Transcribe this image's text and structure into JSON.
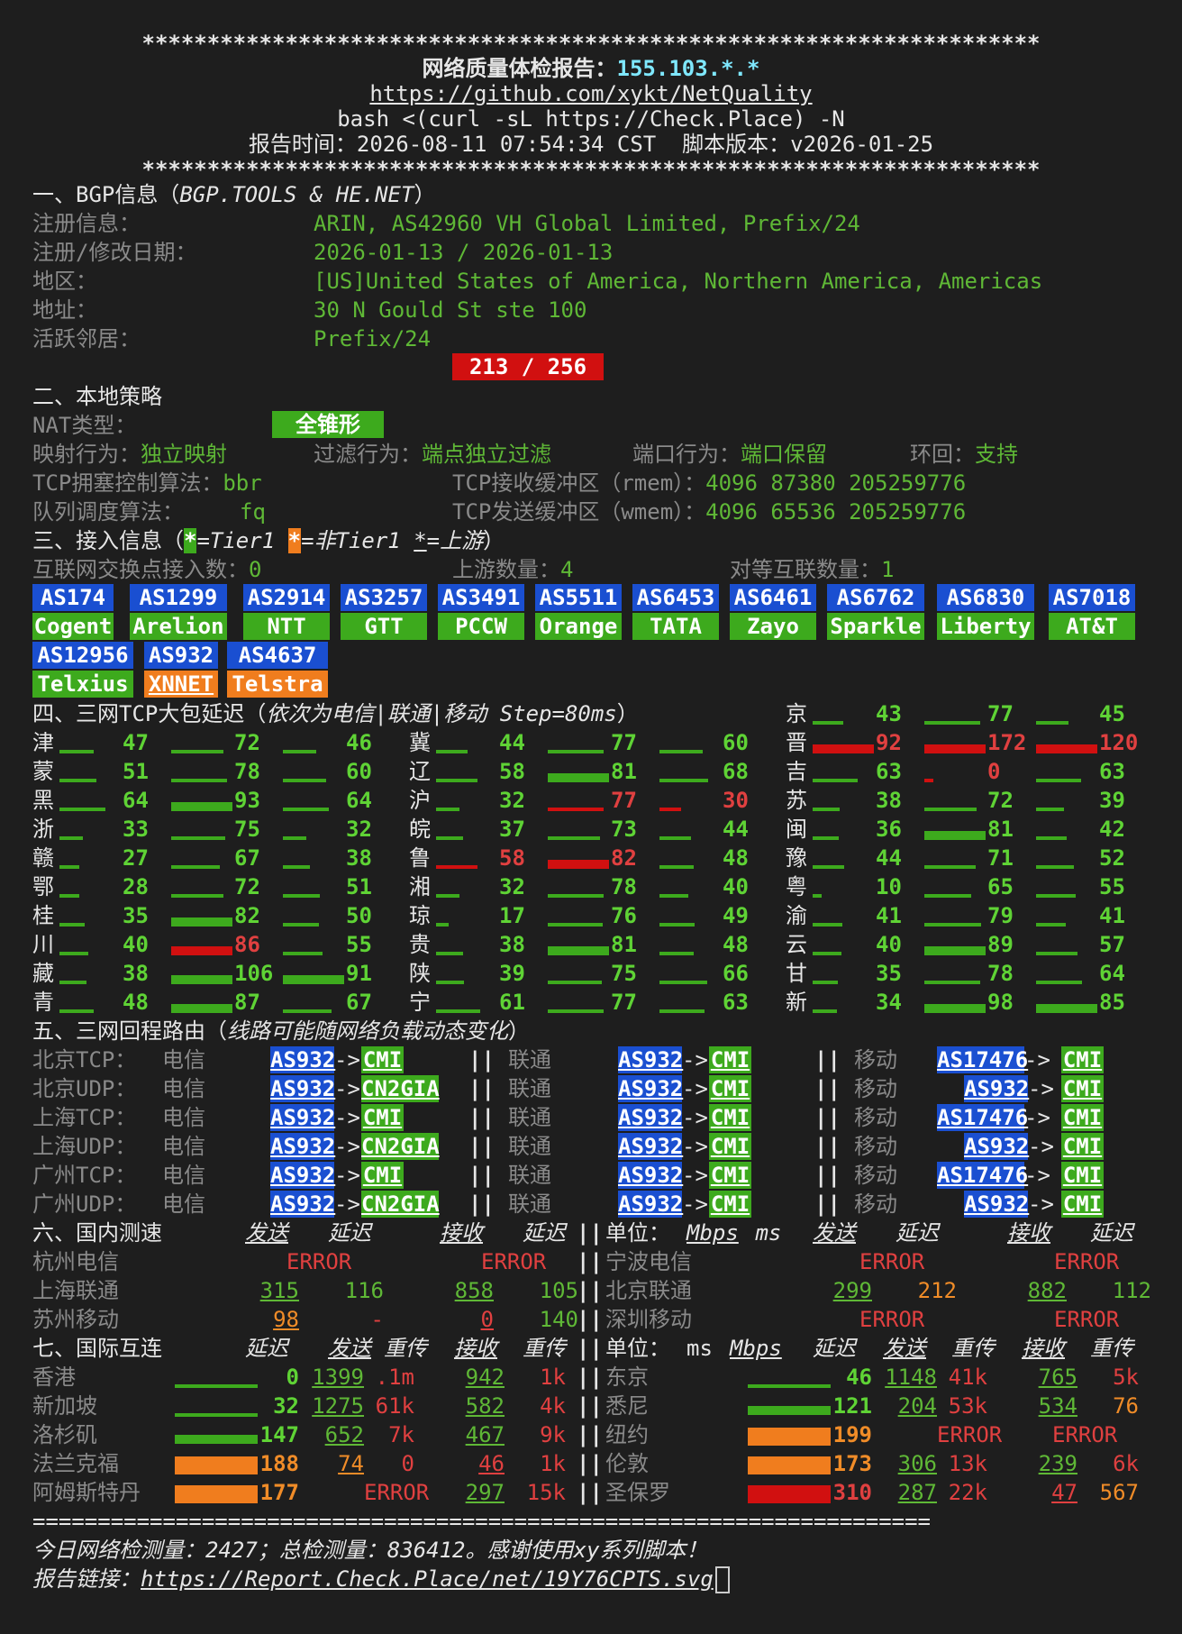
{
  "header": {
    "stars": "*********************************************************************",
    "title": "网络质量体检报告：",
    "ip": "155.103.*.*",
    "repo_url": "https://github.com/xykt/NetQuality",
    "command": "bash <(curl -sL https://Check.Place) -N",
    "report_time": "报告时间：2026-08-11 07:54:34 CST  脚本版本：v2026-01-25"
  },
  "bgp": {
    "section": "一、BGP信息（",
    "source": "BGP.TOOLS & HE.NET",
    "close": "）",
    "rows": [
      {
        "label": "注册信息：",
        "value": "ARIN, AS42960 VH Global Limited, Prefix/24"
      },
      {
        "label": "注册/修改日期：",
        "value": "2026-01-13 / 2026-01-13"
      },
      {
        "label": "地区：",
        "value": "[US]United States of America, Northern America, Americas"
      },
      {
        "label": "地址：",
        "value": "30 N Gould St ste 100"
      },
      {
        "label": "活跃邻居：",
        "value": "Prefix/24"
      }
    ],
    "neighbors": "213 / 256"
  },
  "local": {
    "section": "二、本地策略",
    "nat_label": "NAT类型：",
    "nat_value": "全锥形",
    "mapping_label": "映射行为：",
    "mapping_value": "独立映射",
    "filter_label": "过滤行为：",
    "filter_value": "端点独立过滤",
    "port_label": "端口行为：",
    "port_value": "端口保留",
    "loop_label": "环回：",
    "loop_value": "支持",
    "tcp_cc_label": "TCP拥塞控制算法：",
    "tcp_cc_value": "bbr",
    "rmem_label": "TCP接收缓冲区（rmem）：",
    "rmem_value": "4096 87380 205259776",
    "qdisc_label": "队列调度算法：",
    "qdisc_value": "fq",
    "wmem_label": "TCP发送缓冲区（wmem）：",
    "wmem_value": "4096 65536 205259776"
  },
  "access": {
    "section": "三、接入信息（",
    "legend1": "=Tier1 ",
    "legend2": "=非Tier1 ",
    "legend3": "=上游",
    "close": "）",
    "star": "*",
    "ix_label": "互联网交换点接入数：",
    "ix_value": "0",
    "upstream_label": "上游数量：",
    "upstream_value": "4",
    "peer_label": "对等互联数量：",
    "peer_value": "1",
    "as_list": [
      {
        "asn": "AS174",
        "name": "Cogent"
      },
      {
        "asn": "AS1299",
        "name": "Arelion"
      },
      {
        "asn": "AS2914",
        "name": "NTT"
      },
      {
        "asn": "AS3257",
        "name": "GTT"
      },
      {
        "asn": "AS3491",
        "name": "PCCW"
      },
      {
        "asn": "AS5511",
        "name": "Orange"
      },
      {
        "asn": "AS6453",
        "name": "TATA"
      },
      {
        "asn": "AS6461",
        "name": "Zayo"
      },
      {
        "asn": "AS6762",
        "name": "Sparkle"
      },
      {
        "asn": "AS6830",
        "name": "Liberty"
      },
      {
        "asn": "AS7018",
        "name": "AT&T"
      },
      {
        "asn": "AS12956",
        "name": "Telxius"
      },
      {
        "asn": "AS932",
        "name": "XNNET"
      },
      {
        "asn": "AS4637",
        "name": "Telstra"
      }
    ]
  },
  "latency": {
    "section": "四、三网TCP大包延迟（",
    "note": "依次为电信|联通|移动 Step=80ms",
    "close": "）",
    "grid": [
      [
        null,
        null,
        {
          "p": "京",
          "v": [
            "43",
            "77",
            "45"
          ]
        }
      ],
      [
        {
          "p": "津",
          "v": [
            "47",
            "72",
            "46"
          ]
        },
        {
          "p": "冀",
          "v": [
            "44",
            "77",
            "60"
          ]
        },
        {
          "p": "晋",
          "v": [
            "92",
            "172",
            "120"
          ]
        }
      ],
      [
        {
          "p": "蒙",
          "v": [
            "51",
            "78",
            "60"
          ]
        },
        {
          "p": "辽",
          "v": [
            "58",
            "81",
            "68"
          ]
        },
        {
          "p": "吉",
          "v": [
            "63",
            "0",
            "63"
          ]
        }
      ],
      [
        {
          "p": "黑",
          "v": [
            "64",
            "93",
            "64"
          ]
        },
        {
          "p": "沪",
          "v": [
            "32",
            "77",
            "30"
          ]
        },
        {
          "p": "苏",
          "v": [
            "38",
            "72",
            "39"
          ]
        }
      ],
      [
        {
          "p": "浙",
          "v": [
            "33",
            "75",
            "32"
          ]
        },
        {
          "p": "皖",
          "v": [
            "37",
            "73",
            "44"
          ]
        },
        {
          "p": "闽",
          "v": [
            "36",
            "81",
            "42"
          ]
        }
      ],
      [
        {
          "p": "赣",
          "v": [
            "27",
            "67",
            "38"
          ]
        },
        {
          "p": "鲁",
          "v": [
            "58",
            "82",
            "48"
          ]
        },
        {
          "p": "豫",
          "v": [
            "44",
            "71",
            "52"
          ]
        }
      ],
      [
        {
          "p": "鄂",
          "v": [
            "28",
            "72",
            "51"
          ]
        },
        {
          "p": "湘",
          "v": [
            "32",
            "78",
            "40"
          ]
        },
        {
          "p": "粤",
          "v": [
            "10",
            "65",
            "55"
          ]
        }
      ],
      [
        {
          "p": "桂",
          "v": [
            "35",
            "82",
            "50"
          ]
        },
        {
          "p": "琼",
          "v": [
            "17",
            "76",
            "49"
          ]
        },
        {
          "p": "渝",
          "v": [
            "41",
            "79",
            "41"
          ]
        }
      ],
      [
        {
          "p": "川",
          "v": [
            "40",
            "86",
            "55"
          ]
        },
        {
          "p": "贵",
          "v": [
            "38",
            "81",
            "48"
          ]
        },
        {
          "p": "云",
          "v": [
            "40",
            "89",
            "57"
          ]
        }
      ],
      [
        {
          "p": "藏",
          "v": [
            "38",
            "106",
            "91"
          ]
        },
        {
          "p": "陕",
          "v": [
            "39",
            "75",
            "66"
          ]
        },
        {
          "p": "甘",
          "v": [
            "35",
            "78",
            "64"
          ]
        }
      ],
      [
        {
          "p": "青",
          "v": [
            "48",
            "87",
            "67"
          ]
        },
        {
          "p": "宁",
          "v": [
            "61",
            "77",
            "63"
          ]
        },
        {
          "p": "新",
          "v": [
            "34",
            "98",
            "85"
          ]
        }
      ]
    ]
  },
  "routes": {
    "section": "五、三网回程路由（",
    "note": "线路可能随网络负载动态变化",
    "close": "）",
    "telecom": "电信",
    "unicom": "联通",
    "mobile": "移动",
    "sep": "||",
    "arrow": "->",
    "rows": [
      {
        "label": "北京TCP：",
        "ct": [
          "AS932",
          "CMI"
        ],
        "cu": [
          "AS932",
          "CMI"
        ],
        "cm": [
          "AS17476",
          "CMI"
        ]
      },
      {
        "label": "北京UDP：",
        "ct": [
          "AS932",
          "CN2GIA"
        ],
        "cu": [
          "AS932",
          "CMI"
        ],
        "cm": [
          "AS932",
          "CMI"
        ]
      },
      {
        "label": "上海TCP：",
        "ct": [
          "AS932",
          "CMI"
        ],
        "cu": [
          "AS932",
          "CMI"
        ],
        "cm": [
          "AS17476",
          "CMI"
        ]
      },
      {
        "label": "上海UDP：",
        "ct": [
          "AS932",
          "CN2GIA"
        ],
        "cu": [
          "AS932",
          "CMI"
        ],
        "cm": [
          "AS932",
          "CMI"
        ]
      },
      {
        "label": "广州TCP：",
        "ct": [
          "AS932",
          "CMI"
        ],
        "cu": [
          "AS932",
          "CMI"
        ],
        "cm": [
          "AS17476",
          "CMI"
        ]
      },
      {
        "label": "广州UDP：",
        "ct": [
          "AS932",
          "CN2GIA"
        ],
        "cu": [
          "AS932",
          "CMI"
        ],
        "cm": [
          "AS932",
          "CMI"
        ]
      }
    ]
  },
  "domestic": {
    "section": "六、国内测速",
    "h_send": "发送",
    "h_lat": "延迟",
    "h_recv": "接收",
    "h_lat2": "延迟",
    "sep": "||",
    "unit": "单位：",
    "unit_a": "Mbps",
    "unit_b": " ms",
    "left": [
      {
        "name": "杭州电信",
        "send": "ERROR",
        "lat": "",
        "recv": "ERROR",
        "lat2": ""
      },
      {
        "name": "上海联通",
        "send": "315",
        "lat": "116",
        "recv": "858",
        "lat2": "105"
      },
      {
        "name": "苏州移动",
        "send": "98",
        "lat": "-",
        "recv": "0",
        "lat2": "140"
      }
    ],
    "right": [
      {
        "name": "宁波电信",
        "send": "ERROR",
        "lat": "",
        "recv": "ERROR",
        "lat2": ""
      },
      {
        "name": "北京联通",
        "send": "299",
        "lat": "212",
        "recv": "882",
        "lat2": "112"
      },
      {
        "name": "深圳移动",
        "send": "ERROR",
        "lat": "",
        "recv": "ERROR",
        "lat2": ""
      }
    ]
  },
  "intl": {
    "section": "七、国际互连",
    "h_lat": "延迟",
    "h_send": "发送",
    "h_retx": "重传",
    "h_recv": "接收",
    "h_retx2": "重传",
    "unit": "单位：",
    "unit_a": "ms ",
    "unit_b": "Mbps",
    "left": [
      {
        "name": "香港",
        "lat": "0",
        "send": "1399",
        "retx": ".1m",
        "recv": "942",
        "retx2": "1k"
      },
      {
        "name": "新加坡",
        "lat": "32",
        "send": "1275",
        "retx": "61k",
        "recv": "582",
        "retx2": "4k"
      },
      {
        "name": "洛杉矶",
        "lat": "147",
        "send": "652",
        "retx": "7k",
        "recv": "467",
        "retx2": "9k"
      },
      {
        "name": "法兰克福",
        "lat": "188",
        "send": "74",
        "retx": "0",
        "recv": "46",
        "retx2": "1k"
      },
      {
        "name": "阿姆斯特丹",
        "lat": "177",
        "send": "ERROR",
        "retx": "",
        "recv": "297",
        "retx2": "15k"
      }
    ],
    "right": [
      {
        "name": "东京",
        "lat": "46",
        "send": "1148",
        "retx": "41k",
        "recv": "765",
        "retx2": "5k"
      },
      {
        "name": "悉尼",
        "lat": "121",
        "send": "204",
        "retx": "53k",
        "recv": "534",
        "retx2": "76"
      },
      {
        "name": "纽约",
        "lat": "199",
        "send": "ERROR",
        "retx": "",
        "recv": "ERROR",
        "retx2": ""
      },
      {
        "name": "伦敦",
        "lat": "173",
        "send": "306",
        "retx": "13k",
        "recv": "239",
        "retx2": "6k"
      },
      {
        "name": "圣保罗",
        "lat": "310",
        "send": "287",
        "retx": "22k",
        "recv": "47",
        "retx2": "567"
      }
    ]
  },
  "footer": {
    "rule": "=====================================================================",
    "stats": "今日网络检测量：2427；总检测量：836412。感谢使用xy系列脚本！",
    "link_label": "报告链接：",
    "link": "https://Report.Check.Place/net/19Y76CPTS.svg"
  }
}
